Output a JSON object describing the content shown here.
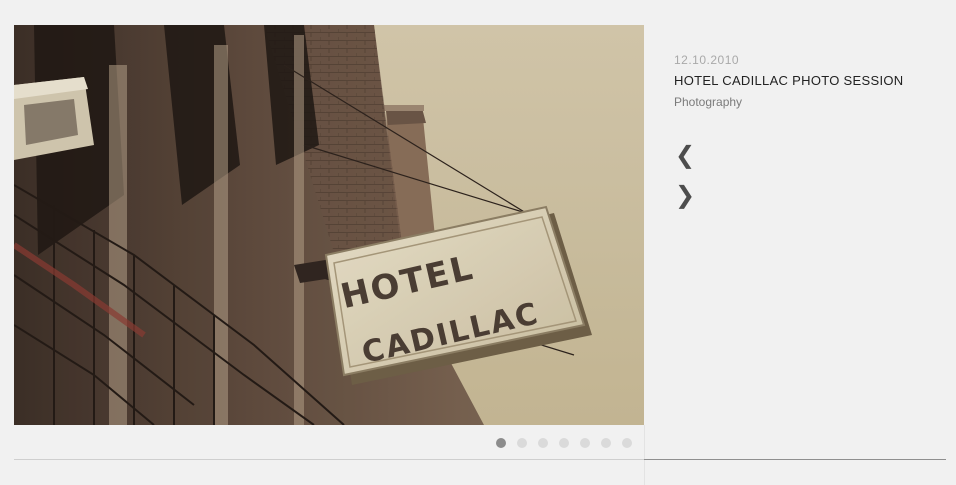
{
  "post": {
    "date": "12.10.2010",
    "title": "HOTEL CADILLAC PHOTO SESSION",
    "category": "Photography"
  },
  "photo": {
    "description": "Vintage Hotel Cadillac sign on brick building",
    "sign_line1": "HOTEL",
    "sign_line2": "CADILLAC"
  },
  "navigation": {
    "prev_icon": "❮",
    "next_icon": "❯"
  },
  "pagination": {
    "total": 7,
    "active_index": 0
  },
  "colors": {
    "background": "#f1f1f1",
    "accent_dot": "#8c8c8c",
    "inactive_dot": "#dadada",
    "title_text": "#222222",
    "meta_text": "#a9a9a9"
  }
}
